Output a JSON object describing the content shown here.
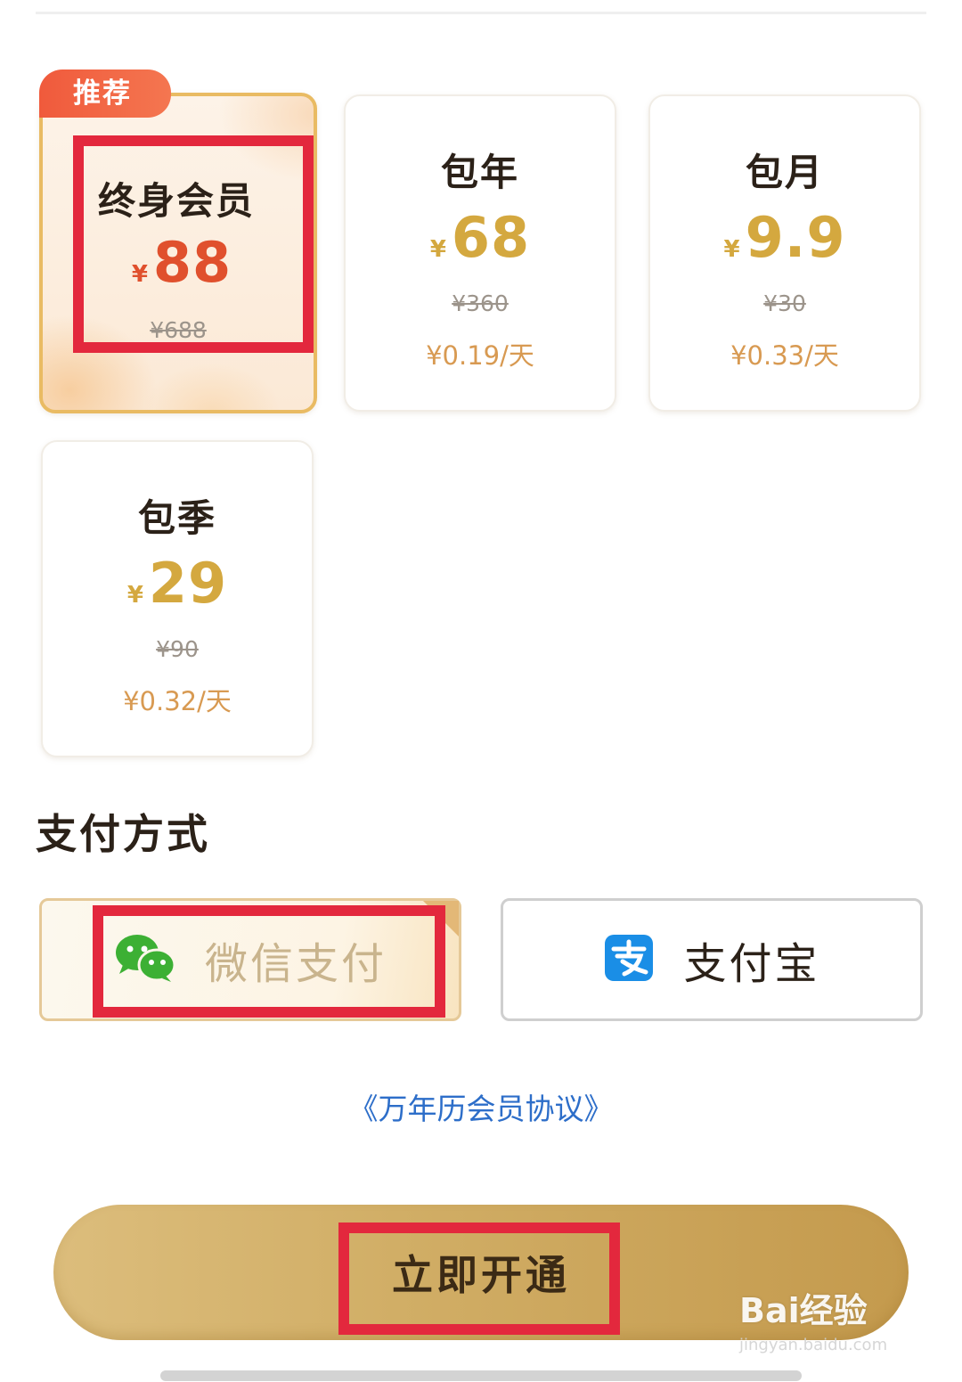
{
  "plans": [
    {
      "name": "终身会员",
      "currency": "¥",
      "price": "88",
      "original": "¥688",
      "per_day": "",
      "badge": "推荐",
      "selected": true
    },
    {
      "name": "包年",
      "currency": "¥",
      "price": "68",
      "original": "¥360",
      "per_day": "¥0.19/天",
      "selected": false
    },
    {
      "name": "包月",
      "currency": "¥",
      "price": "9.9",
      "original": "¥30",
      "per_day": "¥0.33/天",
      "selected": false
    },
    {
      "name": "包季",
      "currency": "¥",
      "price": "29",
      "original": "¥90",
      "per_day": "¥0.32/天",
      "selected": false
    }
  ],
  "payment": {
    "title": "支付方式",
    "methods": [
      {
        "label": "微信支付",
        "icon": "wechat-icon",
        "selected": true
      },
      {
        "label": "支付宝",
        "icon": "alipay-icon",
        "selected": false
      }
    ]
  },
  "agreement": "《万年历会员协议》",
  "cta": {
    "label": "立即开通"
  },
  "watermark": {
    "main": "Bai经验",
    "sub": "jingyan.baidu.com"
  },
  "colors": {
    "gold": "#d4a83f",
    "red": "#e0502d",
    "highlight": "#e3283d",
    "link": "#2d6ec9"
  }
}
